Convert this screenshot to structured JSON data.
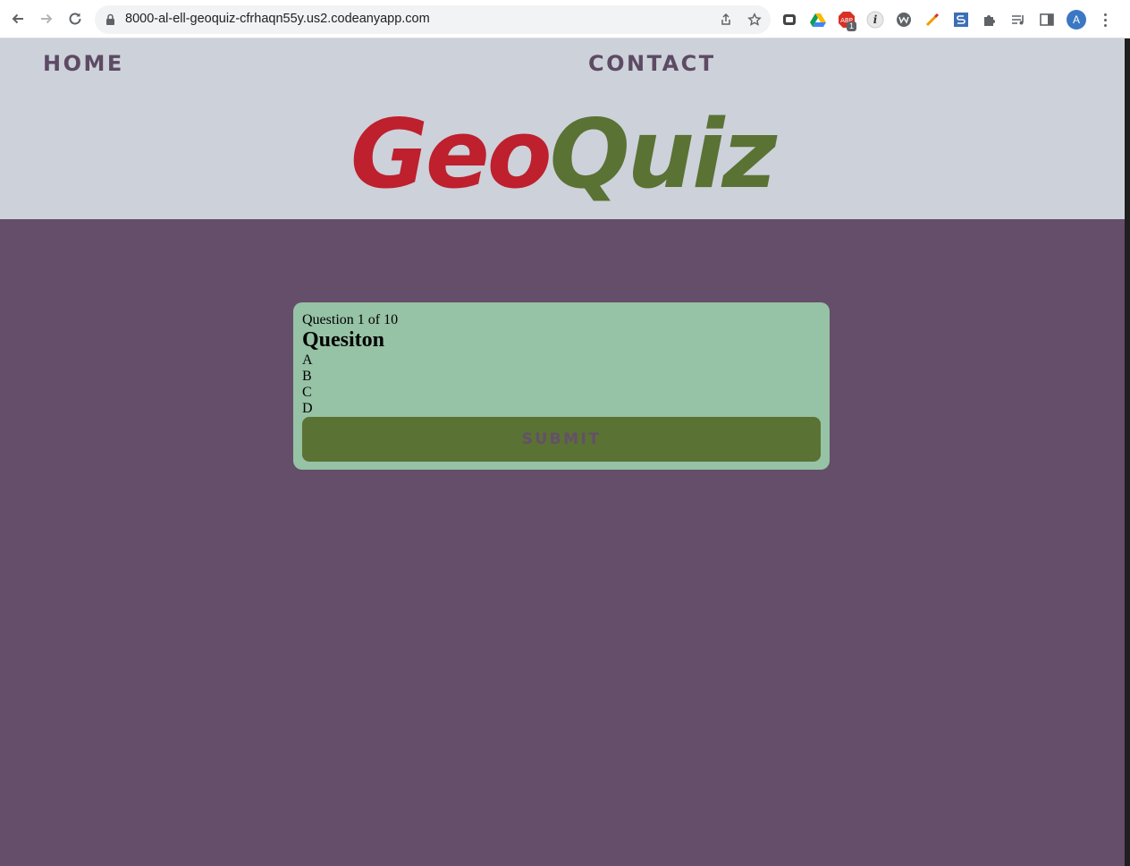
{
  "browser": {
    "url": "8000-al-ell-geoquiz-cfrhaqn55y.us2.codeanyapp.com",
    "abp_badge": "1",
    "profile_initial": "A"
  },
  "nav": {
    "home": "HOME",
    "contact": "CONTACT"
  },
  "logo": {
    "part1": "Geo",
    "part2": "Quiz"
  },
  "quiz": {
    "counter": "Question 1 of 10",
    "question": "Quesiton",
    "answers": [
      "A",
      "B",
      "C",
      "D"
    ],
    "submit_label": "SUBMIT"
  },
  "colors": {
    "header_bg": "#cdd1da",
    "page_bg": "#644e69",
    "card_bg": "#96c2a5",
    "logo_red": "#be202d",
    "logo_green": "#5a7233",
    "submit_bg": "#5a7233"
  }
}
